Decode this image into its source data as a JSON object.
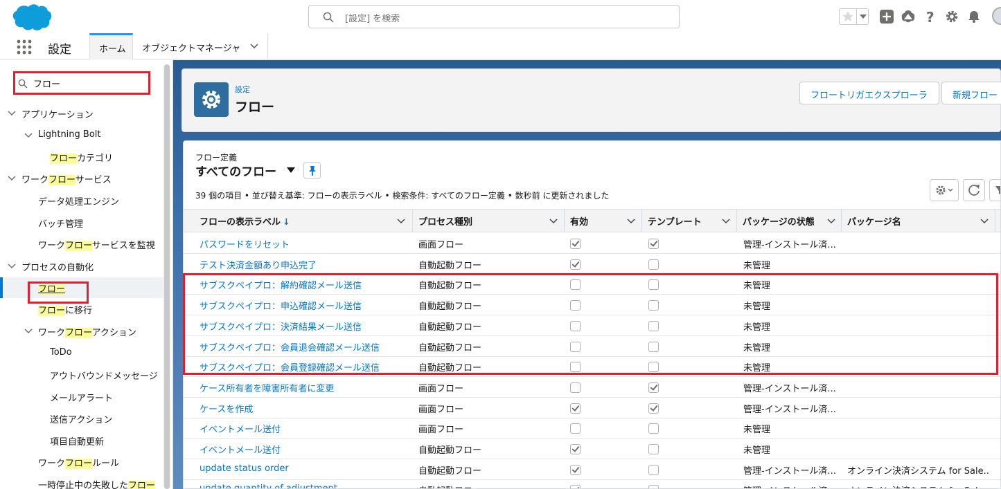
{
  "header": {
    "search_placeholder": "[設定] を検索"
  },
  "context": {
    "app_name": "設定",
    "tabs": [
      {
        "label": "ホーム"
      },
      {
        "label": "オブジェクトマネージャ"
      }
    ]
  },
  "sidebar": {
    "search_value": "フロー",
    "items": [
      {
        "pre": "",
        "hl": "",
        "post": "アプリケーション"
      },
      {
        "pre": "",
        "hl": "",
        "post": "Lightning Bolt"
      },
      {
        "pre": "",
        "hl": "フロー",
        "post": "カテゴリ"
      },
      {
        "pre": "ワーク",
        "hl": "フロー",
        "post": "サービス"
      },
      {
        "pre": "",
        "hl": "",
        "post": "データ処理エンジン"
      },
      {
        "pre": "",
        "hl": "",
        "post": "バッチ管理"
      },
      {
        "pre": "ワーク",
        "hl": "フロー",
        "post": "サービスを監視"
      },
      {
        "pre": "",
        "hl": "",
        "post": "プロセスの自動化"
      },
      {
        "pre": "",
        "hl": "フロー",
        "post": ""
      },
      {
        "pre": "",
        "hl": "フロー",
        "post": "に移行"
      },
      {
        "pre": "ワーク",
        "hl": "フロー",
        "post": "アクション"
      },
      {
        "pre": "",
        "hl": "",
        "post": "ToDo"
      },
      {
        "pre": "",
        "hl": "",
        "post": "アウトバウンドメッセージ"
      },
      {
        "pre": "",
        "hl": "",
        "post": "メールアラート"
      },
      {
        "pre": "",
        "hl": "",
        "post": "送信アクション"
      },
      {
        "pre": "",
        "hl": "",
        "post": "項目自動更新"
      },
      {
        "pre": "ワーク",
        "hl": "フロー",
        "post": "ルール"
      },
      {
        "pre": "一時停止中の失敗した",
        "hl": "フロー",
        "post": ""
      }
    ]
  },
  "page": {
    "breadcrumb": "設定",
    "title": "フロー",
    "trigger_explorer_button": "フロートリガエクスプローラ",
    "new_flow_button": "新規フロー"
  },
  "list_view": {
    "type_label": "フロー定義",
    "name": "すべてのフロー",
    "info": "39 個の項目 • 並び替え基準: フローの表示ラベル • 検索条件: すべてのフロー定義 • 数秒前 に更新されました",
    "columns": [
      {
        "label": "フローの表示ラベル",
        "sort": "↓"
      },
      {
        "label": "プロセス種別"
      },
      {
        "label": "有効"
      },
      {
        "label": "テンプレート"
      },
      {
        "label": "パッケージの状態"
      },
      {
        "label": "パッケージ名"
      }
    ],
    "rows": [
      {
        "label": "パスワードをリセット",
        "process": "画面フロー",
        "active": true,
        "template": true,
        "pkg_state": "管理-インストール済...",
        "pkg_name": ""
      },
      {
        "label": "テスト決済金額あり申込完了",
        "process": "自動起動フロー",
        "active": true,
        "template": false,
        "pkg_state": "未管理",
        "pkg_name": ""
      },
      {
        "label": "サブスクペイプロ：解約確認メール送信",
        "process": "自動起動フロー",
        "active": false,
        "template": false,
        "pkg_state": "未管理",
        "pkg_name": ""
      },
      {
        "label": "サブスクペイプロ：申込確認メール送信",
        "process": "自動起動フロー",
        "active": false,
        "template": false,
        "pkg_state": "未管理",
        "pkg_name": ""
      },
      {
        "label": "サブスクペイプロ：決済結果メール送信",
        "process": "自動起動フロー",
        "active": false,
        "template": false,
        "pkg_state": "未管理",
        "pkg_name": ""
      },
      {
        "label": "サブスクペイプロ：会員退会確認メール送信",
        "process": "自動起動フロー",
        "active": false,
        "template": false,
        "pkg_state": "未管理",
        "pkg_name": ""
      },
      {
        "label": "サブスクペイプロ：会員登録確認メール送信",
        "process": "自動起動フロー",
        "active": false,
        "template": false,
        "pkg_state": "未管理",
        "pkg_name": ""
      },
      {
        "label": "ケース所有者を障害所有者に変更",
        "process": "画面フロー",
        "active": false,
        "template": true,
        "pkg_state": "管理-インストール済...",
        "pkg_name": ""
      },
      {
        "label": "ケースを作成",
        "process": "画面フロー",
        "active": true,
        "template": true,
        "pkg_state": "管理-インストール済...",
        "pkg_name": ""
      },
      {
        "label": "イベントメール送付",
        "process": "画面フロー",
        "active": false,
        "template": false,
        "pkg_state": "未管理",
        "pkg_name": ""
      },
      {
        "label": "イベントメール送付",
        "process": "自動起動フロー",
        "active": true,
        "template": false,
        "pkg_state": "未管理",
        "pkg_name": ""
      },
      {
        "label": "update status order",
        "process": "自動起動フロー",
        "active": true,
        "template": false,
        "pkg_state": "管理-インストール済...",
        "pkg_name": "オンライン決済システム for Sale..."
      },
      {
        "label": "update quantity of adjustment",
        "process": "自動起動フロー",
        "active": true,
        "template": false,
        "pkg_state": "管理-インストール済...",
        "pkg_name": "オンライン決済システム for Sale..."
      }
    ]
  },
  "colors": {
    "brand_blue": "#0176d3",
    "highlight": "#fbfb9a",
    "annotation_red": "#e0202e"
  }
}
